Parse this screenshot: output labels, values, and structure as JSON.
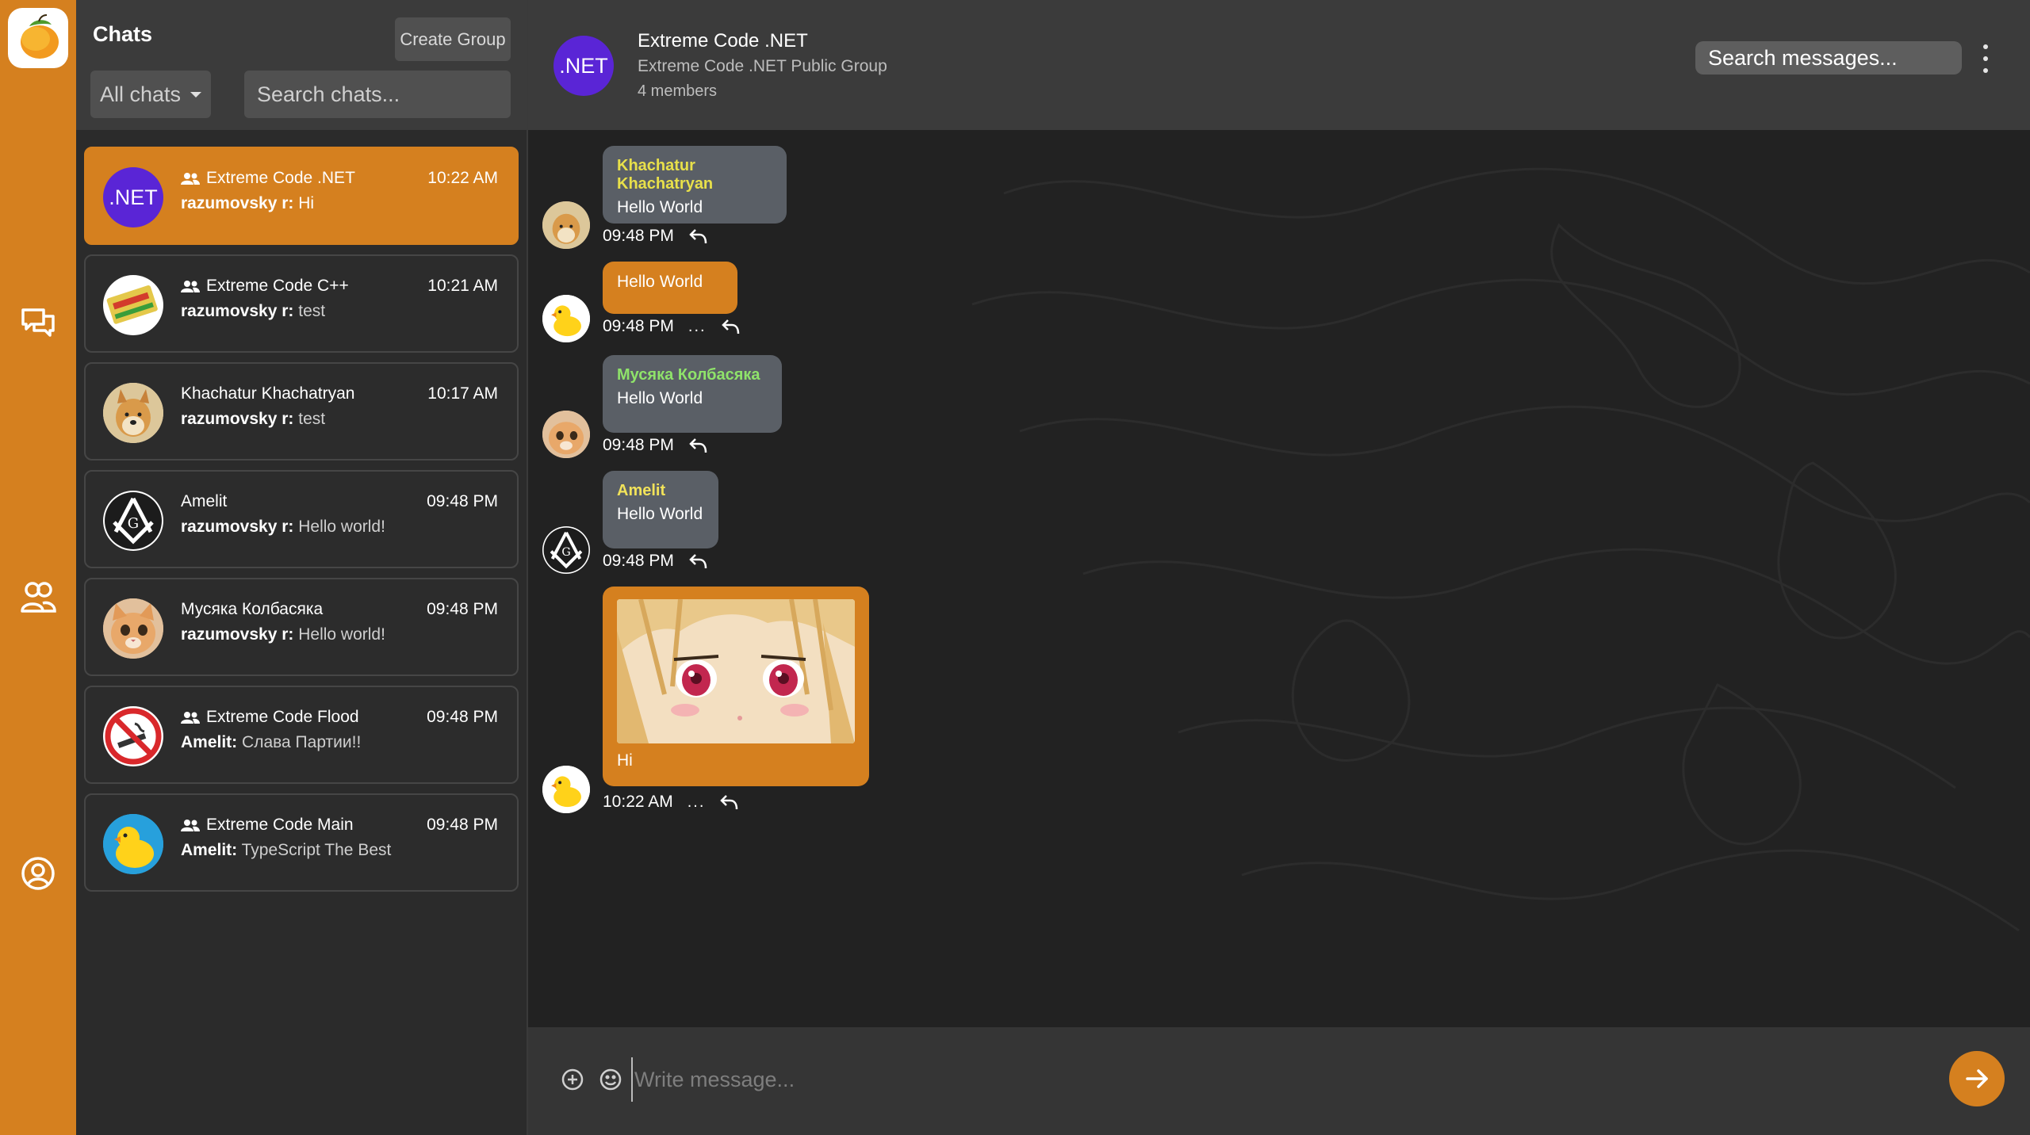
{
  "colors": {
    "accent": "#d5801f",
    "sidebar_bg": "#2b2b2b",
    "header_bg": "#3b3b3b",
    "bubble_other": "#5a5f66",
    "group_avatar": "#5a25d6",
    "sender_khachatur": "#e8e04a",
    "sender_musyaka": "#8fe36a",
    "sender_amelit": "#f2e35a"
  },
  "rail": {
    "logo_icon": "mango-logo-icon",
    "items": [
      {
        "icon": "chats-icon"
      },
      {
        "icon": "contacts-icon"
      },
      {
        "icon": "profile-icon"
      }
    ]
  },
  "sidebar": {
    "title": "Chats",
    "create_group_label": "Create Group",
    "filter_value": "All chats",
    "search_placeholder": "Search chats...",
    "chats": [
      {
        "name": "Extreme Code .NET",
        "group": true,
        "time": "10:22 AM",
        "sender": "razumovsky r:",
        "text": " Hi",
        "avatar": ".NET",
        "active": true
      },
      {
        "name": "Extreme Code C++",
        "group": true,
        "time": "10:21 AM",
        "sender": "razumovsky r:",
        "text": " test",
        "avatar": "cpp-book"
      },
      {
        "name": "Khachatur Khachatryan",
        "group": false,
        "time": "10:17 AM",
        "sender": "razumovsky r:",
        "text": " test",
        "avatar": "doge"
      },
      {
        "name": "Amelit",
        "group": false,
        "time": "09:48 PM",
        "sender": "razumovsky r:",
        "text": " Hello world!",
        "avatar": "masonic"
      },
      {
        "name": "Мусяка Колбасяка",
        "group": false,
        "time": "09:48 PM",
        "sender": "razumovsky r:",
        "text": " Hello world!",
        "avatar": "cat"
      },
      {
        "name": "Extreme Code Flood",
        "group": true,
        "time": "09:48 PM",
        "sender": "Amelit:",
        "text": " Слава Партии!!",
        "avatar": "no-smoking"
      },
      {
        "name": "Extreme Code Main",
        "group": true,
        "time": "09:48 PM",
        "sender": "Amelit:",
        "text": " TypeScript The Best",
        "avatar": "duck"
      }
    ]
  },
  "header": {
    "avatar_text": ".NET",
    "title": "Extreme Code .NET",
    "subtitle": "Extreme Code .NET Public Group",
    "members": "4 members",
    "search_placeholder": "Search messages..."
  },
  "messages": [
    {
      "sender": "Khachatur Khachatryan",
      "text": "Hello World",
      "time": "09:48 PM",
      "mine": false
    },
    {
      "sender": "",
      "text": "Hello World",
      "time": "09:48 PM",
      "mine": true
    },
    {
      "sender": "Мусяка Колбасяка",
      "text": "Hello World",
      "time": "09:48 PM",
      "mine": false
    },
    {
      "sender": "Amelit",
      "text": "Hello World",
      "time": "09:48 PM",
      "mine": false
    },
    {
      "sender": "",
      "text": "Hi",
      "time": "10:22 AM",
      "mine": true,
      "has_image": true
    }
  ],
  "message_more": "...",
  "composer": {
    "placeholder": "Write message..."
  }
}
